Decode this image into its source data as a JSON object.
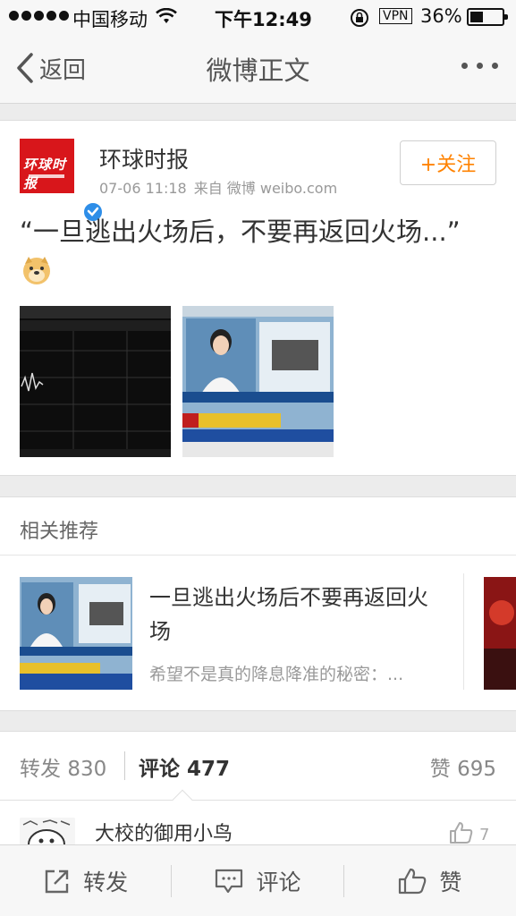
{
  "status_bar": {
    "carrier": "中国移动",
    "time": "下午12:49",
    "vpn": "VPN",
    "battery": "36%"
  },
  "nav": {
    "back_label": "返回",
    "title": "微博正文"
  },
  "post": {
    "author": "环球时报",
    "time": "07-06 11:18",
    "source": "来自 微博 weibo.com",
    "follow_label": "+关注",
    "text": "“一旦逃出火场后，不要再返回火场...”",
    "avatar_logo": "环球时报"
  },
  "related": {
    "section_title": "相关推荐",
    "items": [
      {
        "headline": "一旦逃出火场后不要再返回火场",
        "description": "希望不是真的降息降准的秘密：..."
      }
    ]
  },
  "tabs": {
    "repost_label": "转发",
    "repost_count": "830",
    "comment_label": "评论",
    "comment_count": "477",
    "like_label": "赞",
    "like_count": "695"
  },
  "comment": {
    "user": "大校的御用小鸟",
    "likes": "7"
  },
  "toolbar": {
    "repost": "转发",
    "comment": "评论",
    "like": "赞"
  },
  "colors": {
    "accent": "#ff8200",
    "verified": "#2e8ee8",
    "brand_red": "#d8161b"
  }
}
